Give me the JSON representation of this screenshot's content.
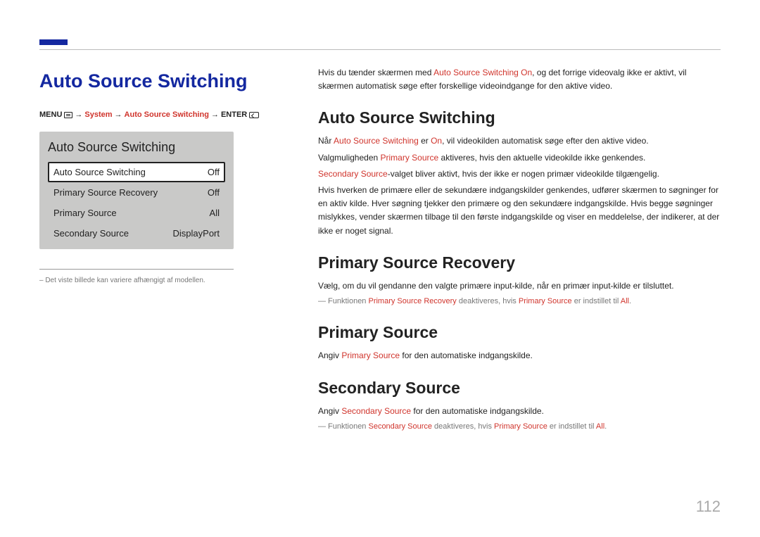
{
  "page": {
    "title": "Auto Source Switching",
    "number": "112"
  },
  "menu_path": {
    "prefix": "MENU",
    "system": "System",
    "item": "Auto Source Switching",
    "enter": "ENTER"
  },
  "panel": {
    "heading": "Auto Source Switching",
    "rows": [
      {
        "label": "Auto Source Switching",
        "value": "Off"
      },
      {
        "label": "Primary Source Recovery",
        "value": "Off"
      },
      {
        "label": "Primary Source",
        "value": "All"
      },
      {
        "label": "Secondary Source",
        "value": "DisplayPort"
      }
    ]
  },
  "left_footnote": "– Det viste billede kan variere afhængigt af modellen.",
  "intro": {
    "line1a": "Hvis du tænder skærmen med ",
    "line1b": "Auto Source Switching On",
    "line1c": ", og det forrige videovalg ikke er aktivt, vil skærmen automatisk søge efter forskellige videoindgange for den aktive video."
  },
  "s1": {
    "heading": "Auto Source Switching",
    "p1a": "Når ",
    "p1b": "Auto Source Switching",
    "p1c": " er ",
    "p1d": "On",
    "p1e": ", vil videokilden automatisk søge efter den aktive video.",
    "p2a": "Valgmuligheden ",
    "p2b": "Primary Source",
    "p2c": " aktiveres, hvis den aktuelle videokilde ikke genkendes.",
    "p3a": "Secondary Source",
    "p3b": "-valget bliver aktivt, hvis der ikke er nogen primær videokilde tilgængelig.",
    "p4": "Hvis hverken de primære eller de sekundære indgangskilder genkendes, udfører skærmen to søgninger for en aktiv kilde. Hver søgning tjekker den primære og den sekundære indgangskilde. Hvis begge søgninger mislykkes, vender skærmen tilbage til den første indgangskilde og viser en meddelelse, der indikerer, at der ikke er noget signal."
  },
  "s2": {
    "heading": "Primary Source Recovery",
    "p1": "Vælg, om du vil gendanne den valgte primære input-kilde, når en primær input-kilde er tilsluttet.",
    "note_a": "Funktionen ",
    "note_b": "Primary Source Recovery",
    "note_c": " deaktiveres, hvis ",
    "note_d": "Primary Source",
    "note_e": " er indstillet til ",
    "note_f": "All",
    "note_g": "."
  },
  "s3": {
    "heading": "Primary Source",
    "p1a": "Angiv ",
    "p1b": "Primary Source",
    "p1c": " for den automatiske indgangskilde."
  },
  "s4": {
    "heading": "Secondary Source",
    "p1a": "Angiv ",
    "p1b": "Secondary Source",
    "p1c": " for den automatiske indgangskilde.",
    "note_a": "Funktionen ",
    "note_b": "Secondary Source",
    "note_c": " deaktiveres, hvis ",
    "note_d": "Primary Source",
    "note_e": " er indstillet til ",
    "note_f": "All",
    "note_g": "."
  }
}
